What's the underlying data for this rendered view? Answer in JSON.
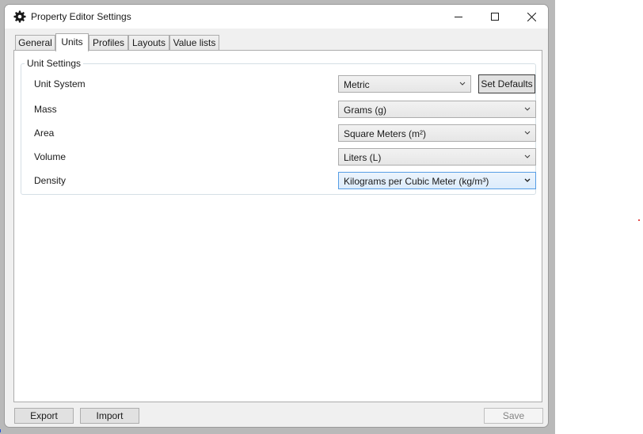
{
  "window": {
    "title": "Property Editor Settings",
    "icons": {
      "app": "gear-icon",
      "minimize": "minimize-icon",
      "maximize": "maximize-icon",
      "close": "close-icon"
    }
  },
  "tabs": [
    {
      "label": "General",
      "selected": false
    },
    {
      "label": "Units",
      "selected": true
    },
    {
      "label": "Profiles",
      "selected": false
    },
    {
      "label": "Layouts",
      "selected": false
    },
    {
      "label": "Value lists",
      "selected": false
    }
  ],
  "unit_settings": {
    "group_title": "Unit Settings",
    "rows": [
      {
        "label": "Unit System",
        "value": "Metric"
      },
      {
        "label": "Mass",
        "value": "Grams (g)"
      },
      {
        "label": "Area",
        "value": "Square Meters (m²)"
      },
      {
        "label": "Volume",
        "value": "Liters (L)"
      },
      {
        "label": "Density",
        "value": "Kilograms per Cubic Meter (kg/m³)"
      }
    ],
    "set_defaults_label": "Set Defaults"
  },
  "footer": {
    "export_label": "Export",
    "import_label": "Import",
    "save_label": "Save"
  },
  "colors": {
    "focus_border": "#569de5",
    "window_bg": "#f0f0f0",
    "panel_bg": "#ffffff"
  }
}
